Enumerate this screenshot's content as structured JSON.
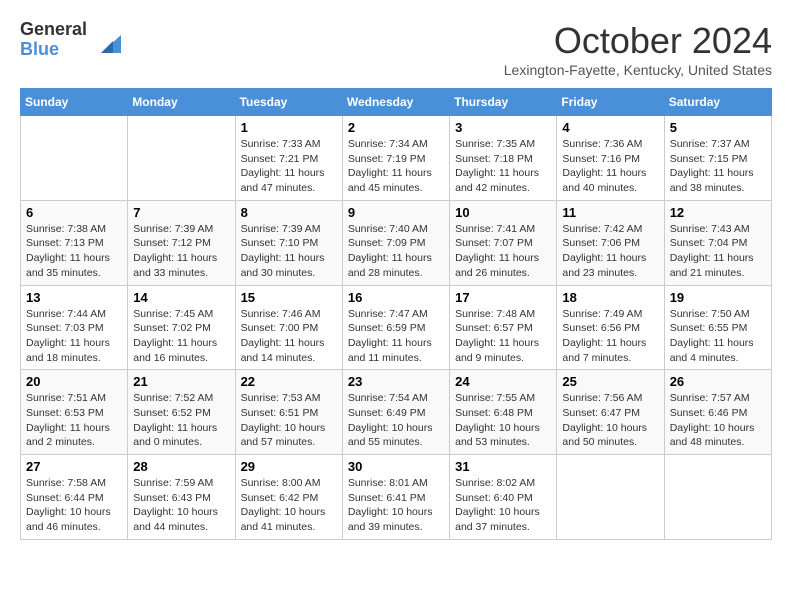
{
  "header": {
    "logo_line1": "General",
    "logo_line2": "Blue",
    "month": "October 2024",
    "location": "Lexington-Fayette, Kentucky, United States"
  },
  "days_of_week": [
    "Sunday",
    "Monday",
    "Tuesday",
    "Wednesday",
    "Thursday",
    "Friday",
    "Saturday"
  ],
  "weeks": [
    [
      {
        "day": "",
        "sunrise": "",
        "sunset": "",
        "daylight": ""
      },
      {
        "day": "",
        "sunrise": "",
        "sunset": "",
        "daylight": ""
      },
      {
        "day": "1",
        "sunrise": "Sunrise: 7:33 AM",
        "sunset": "Sunset: 7:21 PM",
        "daylight": "Daylight: 11 hours and 47 minutes."
      },
      {
        "day": "2",
        "sunrise": "Sunrise: 7:34 AM",
        "sunset": "Sunset: 7:19 PM",
        "daylight": "Daylight: 11 hours and 45 minutes."
      },
      {
        "day": "3",
        "sunrise": "Sunrise: 7:35 AM",
        "sunset": "Sunset: 7:18 PM",
        "daylight": "Daylight: 11 hours and 42 minutes."
      },
      {
        "day": "4",
        "sunrise": "Sunrise: 7:36 AM",
        "sunset": "Sunset: 7:16 PM",
        "daylight": "Daylight: 11 hours and 40 minutes."
      },
      {
        "day": "5",
        "sunrise": "Sunrise: 7:37 AM",
        "sunset": "Sunset: 7:15 PM",
        "daylight": "Daylight: 11 hours and 38 minutes."
      }
    ],
    [
      {
        "day": "6",
        "sunrise": "Sunrise: 7:38 AM",
        "sunset": "Sunset: 7:13 PM",
        "daylight": "Daylight: 11 hours and 35 minutes."
      },
      {
        "day": "7",
        "sunrise": "Sunrise: 7:39 AM",
        "sunset": "Sunset: 7:12 PM",
        "daylight": "Daylight: 11 hours and 33 minutes."
      },
      {
        "day": "8",
        "sunrise": "Sunrise: 7:39 AM",
        "sunset": "Sunset: 7:10 PM",
        "daylight": "Daylight: 11 hours and 30 minutes."
      },
      {
        "day": "9",
        "sunrise": "Sunrise: 7:40 AM",
        "sunset": "Sunset: 7:09 PM",
        "daylight": "Daylight: 11 hours and 28 minutes."
      },
      {
        "day": "10",
        "sunrise": "Sunrise: 7:41 AM",
        "sunset": "Sunset: 7:07 PM",
        "daylight": "Daylight: 11 hours and 26 minutes."
      },
      {
        "day": "11",
        "sunrise": "Sunrise: 7:42 AM",
        "sunset": "Sunset: 7:06 PM",
        "daylight": "Daylight: 11 hours and 23 minutes."
      },
      {
        "day": "12",
        "sunrise": "Sunrise: 7:43 AM",
        "sunset": "Sunset: 7:04 PM",
        "daylight": "Daylight: 11 hours and 21 minutes."
      }
    ],
    [
      {
        "day": "13",
        "sunrise": "Sunrise: 7:44 AM",
        "sunset": "Sunset: 7:03 PM",
        "daylight": "Daylight: 11 hours and 18 minutes."
      },
      {
        "day": "14",
        "sunrise": "Sunrise: 7:45 AM",
        "sunset": "Sunset: 7:02 PM",
        "daylight": "Daylight: 11 hours and 16 minutes."
      },
      {
        "day": "15",
        "sunrise": "Sunrise: 7:46 AM",
        "sunset": "Sunset: 7:00 PM",
        "daylight": "Daylight: 11 hours and 14 minutes."
      },
      {
        "day": "16",
        "sunrise": "Sunrise: 7:47 AM",
        "sunset": "Sunset: 6:59 PM",
        "daylight": "Daylight: 11 hours and 11 minutes."
      },
      {
        "day": "17",
        "sunrise": "Sunrise: 7:48 AM",
        "sunset": "Sunset: 6:57 PM",
        "daylight": "Daylight: 11 hours and 9 minutes."
      },
      {
        "day": "18",
        "sunrise": "Sunrise: 7:49 AM",
        "sunset": "Sunset: 6:56 PM",
        "daylight": "Daylight: 11 hours and 7 minutes."
      },
      {
        "day": "19",
        "sunrise": "Sunrise: 7:50 AM",
        "sunset": "Sunset: 6:55 PM",
        "daylight": "Daylight: 11 hours and 4 minutes."
      }
    ],
    [
      {
        "day": "20",
        "sunrise": "Sunrise: 7:51 AM",
        "sunset": "Sunset: 6:53 PM",
        "daylight": "Daylight: 11 hours and 2 minutes."
      },
      {
        "day": "21",
        "sunrise": "Sunrise: 7:52 AM",
        "sunset": "Sunset: 6:52 PM",
        "daylight": "Daylight: 11 hours and 0 minutes."
      },
      {
        "day": "22",
        "sunrise": "Sunrise: 7:53 AM",
        "sunset": "Sunset: 6:51 PM",
        "daylight": "Daylight: 10 hours and 57 minutes."
      },
      {
        "day": "23",
        "sunrise": "Sunrise: 7:54 AM",
        "sunset": "Sunset: 6:49 PM",
        "daylight": "Daylight: 10 hours and 55 minutes."
      },
      {
        "day": "24",
        "sunrise": "Sunrise: 7:55 AM",
        "sunset": "Sunset: 6:48 PM",
        "daylight": "Daylight: 10 hours and 53 minutes."
      },
      {
        "day": "25",
        "sunrise": "Sunrise: 7:56 AM",
        "sunset": "Sunset: 6:47 PM",
        "daylight": "Daylight: 10 hours and 50 minutes."
      },
      {
        "day": "26",
        "sunrise": "Sunrise: 7:57 AM",
        "sunset": "Sunset: 6:46 PM",
        "daylight": "Daylight: 10 hours and 48 minutes."
      }
    ],
    [
      {
        "day": "27",
        "sunrise": "Sunrise: 7:58 AM",
        "sunset": "Sunset: 6:44 PM",
        "daylight": "Daylight: 10 hours and 46 minutes."
      },
      {
        "day": "28",
        "sunrise": "Sunrise: 7:59 AM",
        "sunset": "Sunset: 6:43 PM",
        "daylight": "Daylight: 10 hours and 44 minutes."
      },
      {
        "day": "29",
        "sunrise": "Sunrise: 8:00 AM",
        "sunset": "Sunset: 6:42 PM",
        "daylight": "Daylight: 10 hours and 41 minutes."
      },
      {
        "day": "30",
        "sunrise": "Sunrise: 8:01 AM",
        "sunset": "Sunset: 6:41 PM",
        "daylight": "Daylight: 10 hours and 39 minutes."
      },
      {
        "day": "31",
        "sunrise": "Sunrise: 8:02 AM",
        "sunset": "Sunset: 6:40 PM",
        "daylight": "Daylight: 10 hours and 37 minutes."
      },
      {
        "day": "",
        "sunrise": "",
        "sunset": "",
        "daylight": ""
      },
      {
        "day": "",
        "sunrise": "",
        "sunset": "",
        "daylight": ""
      }
    ]
  ]
}
